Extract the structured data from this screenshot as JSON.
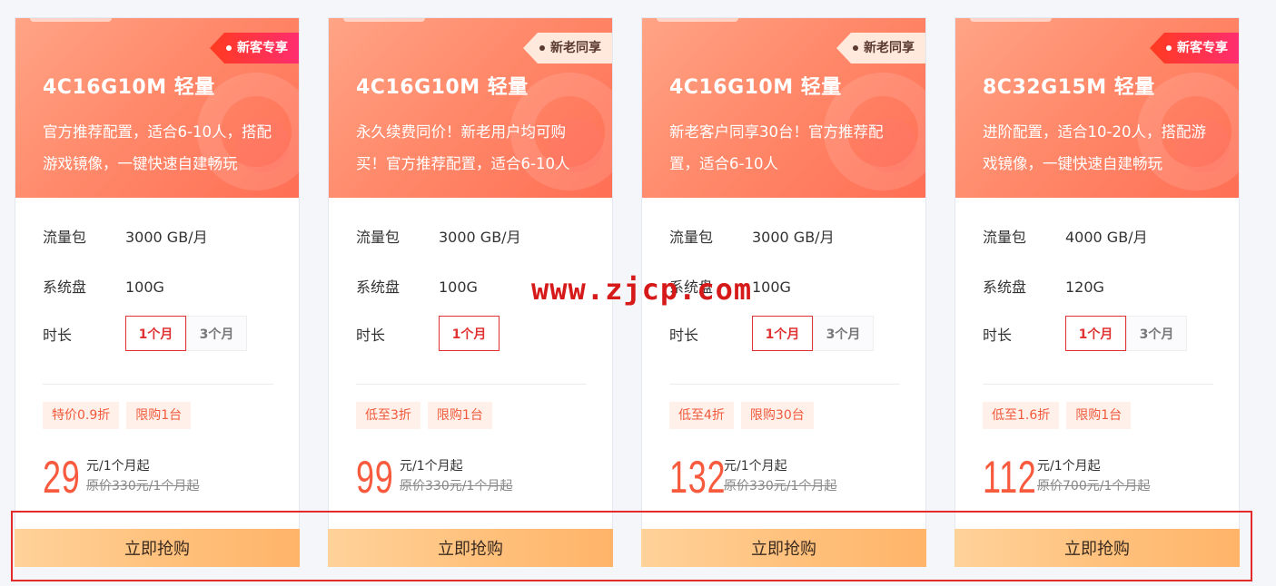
{
  "cards": [
    {
      "tag": "新客专享",
      "tag_type": "new",
      "title": "4C16G10M 轻量",
      "desc": "官方推荐配置，适合6-10人，搭配游戏镜像，一键快速自建畅玩",
      "traffic_label": "流量包",
      "traffic_value": "3000 GB/月",
      "disk_label": "系统盘",
      "disk_value": "100G",
      "duration_label": "时长",
      "duration_options": [
        "1个月",
        "3个月"
      ],
      "badge1": "特价0.9折",
      "badge2": "限购1台",
      "price": "29",
      "price_unit": "元/1个月起",
      "price_original": "原价330元/1个月起",
      "buy_label": "立即抢购"
    },
    {
      "tag": "新老同享",
      "tag_type": "old",
      "title": "4C16G10M 轻量",
      "desc": "永久续费同价！新老用户均可购买！官方推荐配置，适合6-10人",
      "traffic_label": "流量包",
      "traffic_value": "3000 GB/月",
      "disk_label": "系统盘",
      "disk_value": "100G",
      "duration_label": "时长",
      "duration_options": [
        "1个月"
      ],
      "badge1": "低至3折",
      "badge2": "限购1台",
      "price": "99",
      "price_unit": "元/1个月起",
      "price_original": "原价330元/1个月起",
      "buy_label": "立即抢购"
    },
    {
      "tag": "新老同享",
      "tag_type": "old",
      "title": "4C16G10M 轻量",
      "desc": "新老客户同享30台！官方推荐配置，适合6-10人",
      "traffic_label": "流量包",
      "traffic_value": "3000 GB/月",
      "disk_label": "系统盘",
      "disk_value": "100G",
      "duration_label": "时长",
      "duration_options": [
        "1个月",
        "3个月"
      ],
      "badge1": "低至4折",
      "badge2": "限购30台",
      "price": "132",
      "price_unit": "元/1个月起",
      "price_original": "原价330元/1个月起",
      "buy_label": "立即抢购"
    },
    {
      "tag": "新客专享",
      "tag_type": "new",
      "title": "8C32G15M 轻量",
      "desc": "进阶配置，适合10-20人，搭配游戏镜像，一键快速自建畅玩",
      "traffic_label": "流量包",
      "traffic_value": "4000 GB/月",
      "disk_label": "系统盘",
      "disk_value": "120G",
      "duration_label": "时长",
      "duration_options": [
        "1个月",
        "3个月"
      ],
      "badge1": "低至1.6折",
      "badge2": "限购1台",
      "price": "112",
      "price_unit": "元/1个月起",
      "price_original": "原价700元/1个月起",
      "buy_label": "立即抢购"
    }
  ],
  "watermark": "www.zjcp.com",
  "colors": {
    "accent_red": "#e03232",
    "price_orange": "#f85a3e",
    "header_gradient_start": "#ffa486",
    "header_gradient_end": "#ff6f55",
    "buy_button": "#ffc27e"
  }
}
